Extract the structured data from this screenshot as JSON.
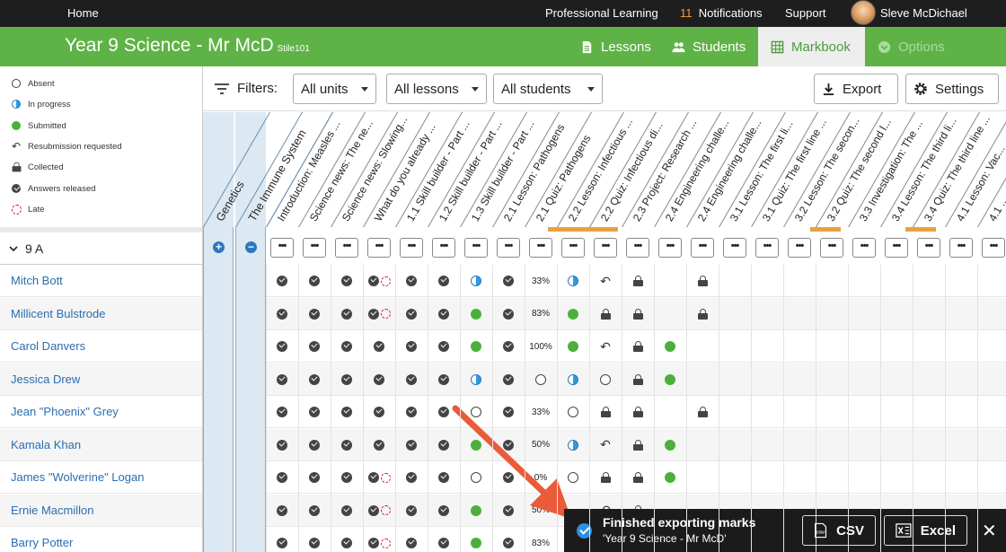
{
  "topbar": {
    "home": "Home",
    "professional_learning": "Professional Learning",
    "notif_count": "11",
    "notifications": "Notifications",
    "support": "Support",
    "user": "Sleve McDichael"
  },
  "header": {
    "title": "Year 9 Science - Mr McD",
    "code": "Stile101",
    "tabs": {
      "lessons": "Lessons",
      "students": "Students",
      "markbook": "Markbook",
      "options": "Options"
    }
  },
  "legend": {
    "absent": "Absent",
    "in_progress": "In progress",
    "submitted": "Submitted",
    "resubmission": "Resubmission requested",
    "collected": "Collected",
    "answers_released": "Answers released",
    "late": "Late"
  },
  "toolbar": {
    "filters": "Filters:",
    "units": "All units",
    "lessons": "All lessons",
    "students": "All students",
    "export": "Export",
    "settings": "Settings"
  },
  "units": [
    "Genetics",
    "The Immune System"
  ],
  "columns": [
    "Introduction: Measles ...",
    "Science news: The ne...",
    "Science news: Slowing...",
    "What do you already ...",
    "1.1 Skill builder - Part ...",
    "1.2 Skill builder - Part ...",
    "1.3 Skill builder - Part ...",
    "2.1 Lesson: Pathogens",
    "2.1 Quiz: Pathogens",
    "2.2 Lesson: Infectious ...",
    "2.2 Quiz: Infectious di...",
    "2.3 Project: Research ...",
    "2.4 Engineering challe...",
    "2.4 Engineering challe...",
    "3.1 Lesson: The first li...",
    "3.1 Quiz: The first line ...",
    "3.2 Lesson: The secon...",
    "3.2 Quiz: The second l...",
    "3.3 Investigation: The ...",
    "3.4 Lesson: The third li...",
    "3.4 Quiz: The third line ...",
    "4.1 Lesson: Vac...",
    "4.1 ..."
  ],
  "group": {
    "name": "9 A"
  },
  "menu_glyph": "•••",
  "students": [
    {
      "name": "Mitch Bott",
      "cells": [
        "check",
        "check",
        "check",
        "check-late",
        "check",
        "check",
        "half",
        "check",
        "33%",
        "half",
        "resub",
        "lock",
        "",
        "lock"
      ]
    },
    {
      "name": "Millicent Bulstrode",
      "cells": [
        "check",
        "check",
        "check",
        "check-late",
        "check",
        "check",
        "green",
        "check",
        "83%",
        "green",
        "lock",
        "lock",
        "",
        "lock"
      ]
    },
    {
      "name": "Carol Danvers",
      "cells": [
        "check",
        "check",
        "check",
        "check",
        "check",
        "check",
        "green",
        "check",
        "100%",
        "green",
        "resub",
        "lock",
        "green",
        ""
      ]
    },
    {
      "name": "Jessica Drew",
      "cells": [
        "check",
        "check",
        "check",
        "check",
        "check",
        "check",
        "half",
        "check",
        "empty",
        "half",
        "empty",
        "lock",
        "green",
        ""
      ]
    },
    {
      "name": "Jean \"Phoenix\" Grey",
      "cells": [
        "check",
        "check",
        "check",
        "check",
        "check",
        "check",
        "empty",
        "check",
        "33%",
        "empty",
        "lock",
        "lock",
        "",
        "lock"
      ]
    },
    {
      "name": "Kamala Khan",
      "cells": [
        "check",
        "check",
        "check",
        "check",
        "check",
        "check",
        "green",
        "check",
        "50%",
        "half",
        "resub",
        "lock",
        "green",
        ""
      ]
    },
    {
      "name": "James \"Wolverine\" Logan",
      "cells": [
        "check",
        "check",
        "check",
        "check-late",
        "check",
        "check",
        "empty",
        "check",
        "0%",
        "empty",
        "lock",
        "lock",
        "green",
        ""
      ]
    },
    {
      "name": "Ernie Macmillon",
      "cells": [
        "check",
        "check",
        "check",
        "check-late",
        "check",
        "check",
        "green",
        "check",
        "50%",
        "",
        "resub",
        "lock",
        "",
        ""
      ]
    },
    {
      "name": "Barry Potter",
      "cells": [
        "check",
        "check",
        "check",
        "check-late",
        "check",
        "check",
        "green",
        "check",
        "83%",
        "",
        "",
        "",
        "",
        ""
      ]
    }
  ],
  "toast": {
    "title": "Finished exporting marks",
    "subtitle": "'Year 9 Science - Mr McD'",
    "csv": "CSV",
    "excel": "Excel"
  }
}
